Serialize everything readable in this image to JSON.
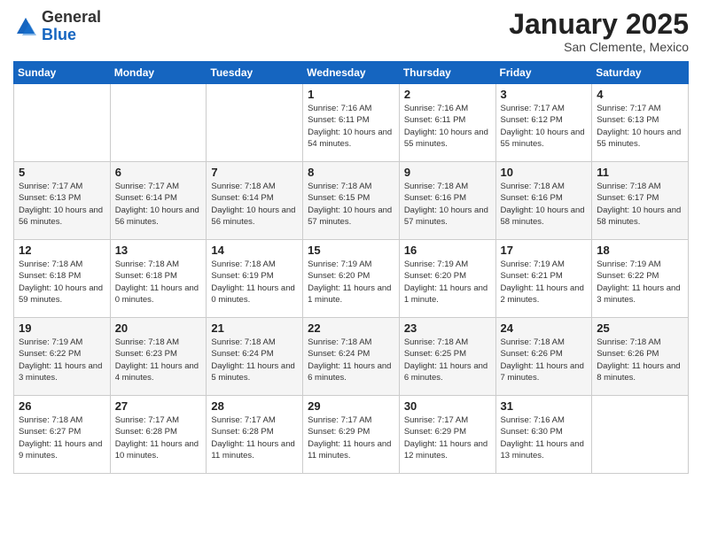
{
  "header": {
    "logo": {
      "general": "General",
      "blue": "Blue"
    },
    "month_title": "January 2025",
    "location": "San Clemente, Mexico"
  },
  "weekdays": [
    "Sunday",
    "Monday",
    "Tuesday",
    "Wednesday",
    "Thursday",
    "Friday",
    "Saturday"
  ],
  "weeks": [
    [
      {
        "day": "",
        "info": ""
      },
      {
        "day": "",
        "info": ""
      },
      {
        "day": "",
        "info": ""
      },
      {
        "day": "1",
        "info": "Sunrise: 7:16 AM\nSunset: 6:11 PM\nDaylight: 10 hours\nand 54 minutes."
      },
      {
        "day": "2",
        "info": "Sunrise: 7:16 AM\nSunset: 6:11 PM\nDaylight: 10 hours\nand 55 minutes."
      },
      {
        "day": "3",
        "info": "Sunrise: 7:17 AM\nSunset: 6:12 PM\nDaylight: 10 hours\nand 55 minutes."
      },
      {
        "day": "4",
        "info": "Sunrise: 7:17 AM\nSunset: 6:13 PM\nDaylight: 10 hours\nand 55 minutes."
      }
    ],
    [
      {
        "day": "5",
        "info": "Sunrise: 7:17 AM\nSunset: 6:13 PM\nDaylight: 10 hours\nand 56 minutes."
      },
      {
        "day": "6",
        "info": "Sunrise: 7:17 AM\nSunset: 6:14 PM\nDaylight: 10 hours\nand 56 minutes."
      },
      {
        "day": "7",
        "info": "Sunrise: 7:18 AM\nSunset: 6:14 PM\nDaylight: 10 hours\nand 56 minutes."
      },
      {
        "day": "8",
        "info": "Sunrise: 7:18 AM\nSunset: 6:15 PM\nDaylight: 10 hours\nand 57 minutes."
      },
      {
        "day": "9",
        "info": "Sunrise: 7:18 AM\nSunset: 6:16 PM\nDaylight: 10 hours\nand 57 minutes."
      },
      {
        "day": "10",
        "info": "Sunrise: 7:18 AM\nSunset: 6:16 PM\nDaylight: 10 hours\nand 58 minutes."
      },
      {
        "day": "11",
        "info": "Sunrise: 7:18 AM\nSunset: 6:17 PM\nDaylight: 10 hours\nand 58 minutes."
      }
    ],
    [
      {
        "day": "12",
        "info": "Sunrise: 7:18 AM\nSunset: 6:18 PM\nDaylight: 10 hours\nand 59 minutes."
      },
      {
        "day": "13",
        "info": "Sunrise: 7:18 AM\nSunset: 6:18 PM\nDaylight: 11 hours\nand 0 minutes."
      },
      {
        "day": "14",
        "info": "Sunrise: 7:18 AM\nSunset: 6:19 PM\nDaylight: 11 hours\nand 0 minutes."
      },
      {
        "day": "15",
        "info": "Sunrise: 7:19 AM\nSunset: 6:20 PM\nDaylight: 11 hours\nand 1 minute."
      },
      {
        "day": "16",
        "info": "Sunrise: 7:19 AM\nSunset: 6:20 PM\nDaylight: 11 hours\nand 1 minute."
      },
      {
        "day": "17",
        "info": "Sunrise: 7:19 AM\nSunset: 6:21 PM\nDaylight: 11 hours\nand 2 minutes."
      },
      {
        "day": "18",
        "info": "Sunrise: 7:19 AM\nSunset: 6:22 PM\nDaylight: 11 hours\nand 3 minutes."
      }
    ],
    [
      {
        "day": "19",
        "info": "Sunrise: 7:19 AM\nSunset: 6:22 PM\nDaylight: 11 hours\nand 3 minutes."
      },
      {
        "day": "20",
        "info": "Sunrise: 7:18 AM\nSunset: 6:23 PM\nDaylight: 11 hours\nand 4 minutes."
      },
      {
        "day": "21",
        "info": "Sunrise: 7:18 AM\nSunset: 6:24 PM\nDaylight: 11 hours\nand 5 minutes."
      },
      {
        "day": "22",
        "info": "Sunrise: 7:18 AM\nSunset: 6:24 PM\nDaylight: 11 hours\nand 6 minutes."
      },
      {
        "day": "23",
        "info": "Sunrise: 7:18 AM\nSunset: 6:25 PM\nDaylight: 11 hours\nand 6 minutes."
      },
      {
        "day": "24",
        "info": "Sunrise: 7:18 AM\nSunset: 6:26 PM\nDaylight: 11 hours\nand 7 minutes."
      },
      {
        "day": "25",
        "info": "Sunrise: 7:18 AM\nSunset: 6:26 PM\nDaylight: 11 hours\nand 8 minutes."
      }
    ],
    [
      {
        "day": "26",
        "info": "Sunrise: 7:18 AM\nSunset: 6:27 PM\nDaylight: 11 hours\nand 9 minutes."
      },
      {
        "day": "27",
        "info": "Sunrise: 7:17 AM\nSunset: 6:28 PM\nDaylight: 11 hours\nand 10 minutes."
      },
      {
        "day": "28",
        "info": "Sunrise: 7:17 AM\nSunset: 6:28 PM\nDaylight: 11 hours\nand 11 minutes."
      },
      {
        "day": "29",
        "info": "Sunrise: 7:17 AM\nSunset: 6:29 PM\nDaylight: 11 hours\nand 11 minutes."
      },
      {
        "day": "30",
        "info": "Sunrise: 7:17 AM\nSunset: 6:29 PM\nDaylight: 11 hours\nand 12 minutes."
      },
      {
        "day": "31",
        "info": "Sunrise: 7:16 AM\nSunset: 6:30 PM\nDaylight: 11 hours\nand 13 minutes."
      },
      {
        "day": "",
        "info": ""
      }
    ]
  ]
}
